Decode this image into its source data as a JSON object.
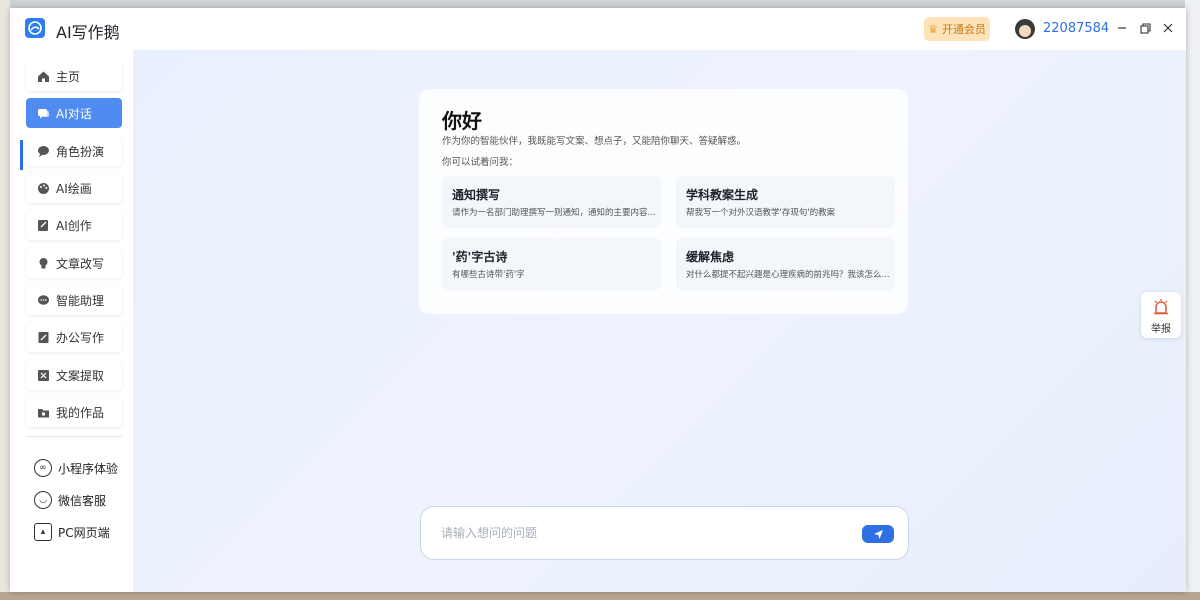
{
  "app": {
    "title": "AI写作鹅"
  },
  "header": {
    "vip_label": "开通会员",
    "user_id": "22087584"
  },
  "sidebar": {
    "items": [
      {
        "label": "主页",
        "icon": "home-icon"
      },
      {
        "label": "AI对话",
        "icon": "chat-icon",
        "active": true
      },
      {
        "label": "角色扮演",
        "icon": "speech-icon"
      },
      {
        "label": "AI绘画",
        "icon": "palette-icon"
      },
      {
        "label": "AI创作",
        "icon": "edit-icon"
      },
      {
        "label": "文章改写",
        "icon": "lightbulb-icon"
      },
      {
        "label": "智能助理",
        "icon": "assistant-icon"
      },
      {
        "label": "办公写作",
        "icon": "document-icon"
      },
      {
        "label": "文案提取",
        "icon": "extract-icon"
      },
      {
        "label": "我的作品",
        "icon": "folder-icon"
      }
    ],
    "extras": [
      {
        "label": "小程序体验",
        "icon": "miniprogram-icon"
      },
      {
        "label": "微信客服",
        "icon": "customer-service-icon"
      },
      {
        "label": "PC网页端",
        "icon": "monitor-icon"
      }
    ]
  },
  "main": {
    "greeting": "你好",
    "intro": "作为你的智能伙伴，我既能写文案、想点子，又能陪你聊天、答疑解惑。",
    "try_label": "你可以试着问我：",
    "suggestions": [
      {
        "title": "通知撰写",
        "desc": "请作为一名部门助理撰写一则通知，通知的主要内容..."
      },
      {
        "title": "学科教案生成",
        "desc": "帮我写一个对外汉语教学'存现句'的教案"
      },
      {
        "title": "'药'字古诗",
        "desc": "有哪些古诗带'药'字"
      },
      {
        "title": "缓解焦虑",
        "desc": "对什么都提不起兴趣是心理疾病的前兆吗？我该怎么..."
      }
    ],
    "input_placeholder": "请输入想问的问题"
  },
  "report": {
    "label": "举报"
  },
  "colors": {
    "accent": "#2f6fe4",
    "active_nav": "#4f8bf0",
    "vip_bg": "#ffe3b8"
  }
}
